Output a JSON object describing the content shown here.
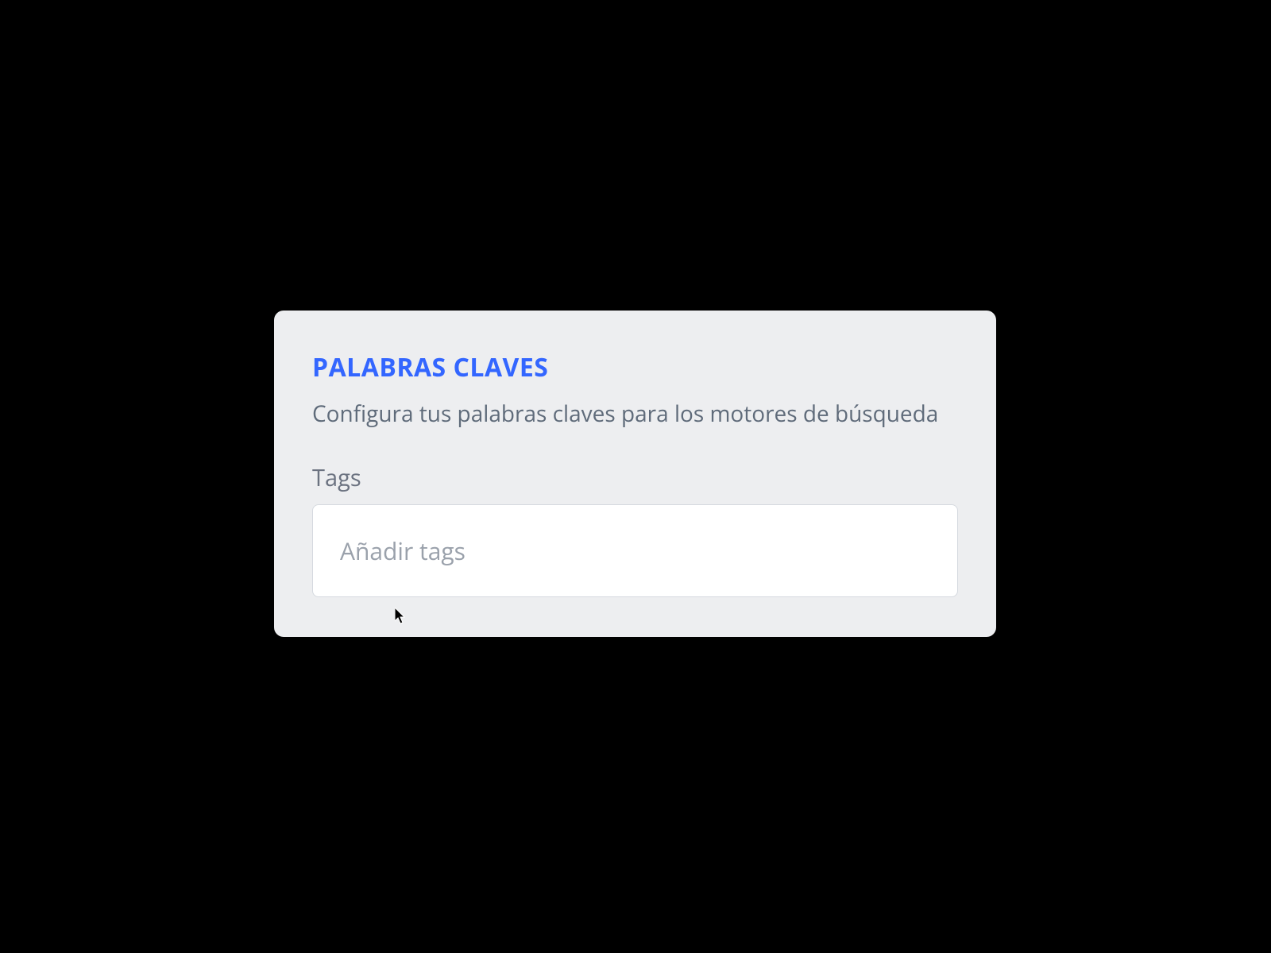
{
  "card": {
    "title": "PALABRAS CLAVES",
    "subtitle": "Configura tus palabras claves para los motores de búsqueda",
    "field_label": "Tags",
    "input_placeholder": "Añadir tags",
    "input_value": ""
  }
}
